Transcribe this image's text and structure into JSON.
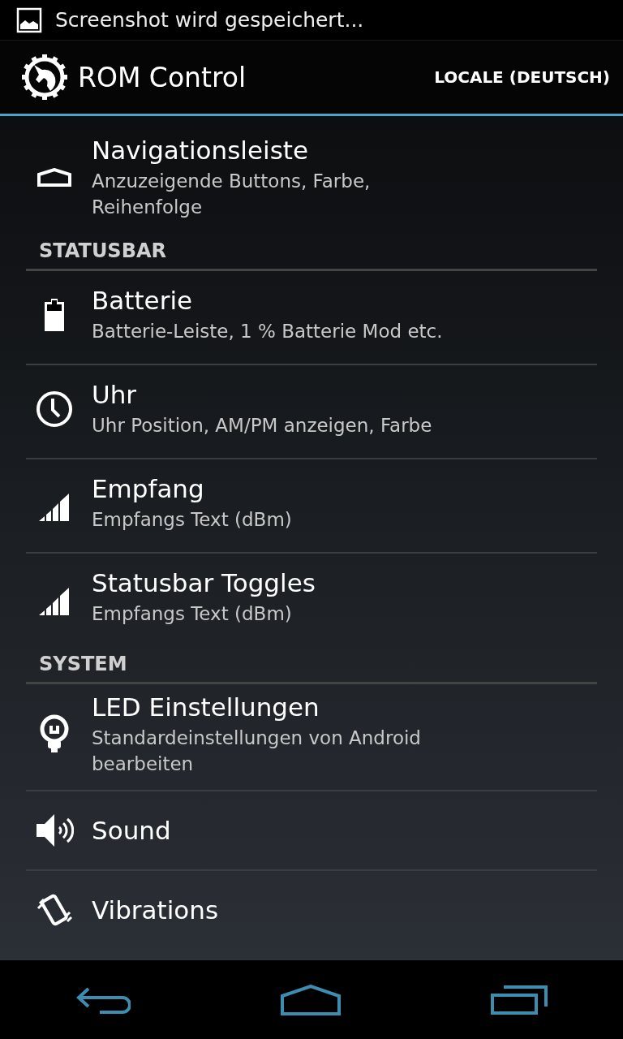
{
  "notification": {
    "text": "Screenshot wird gespeichert..."
  },
  "action_bar": {
    "title": "ROM Control",
    "action": "LOCALE (DEUTSCH)"
  },
  "entries": [
    {
      "kind": "item",
      "title": "Navigationsleiste",
      "summary": "Anzuzeigende Buttons, Farbe, Reihenfolge"
    },
    {
      "kind": "header",
      "title": "STATUSBAR"
    },
    {
      "kind": "item",
      "title": "Batterie",
      "summary": "Batterie-Leiste, 1 % Batterie Mod etc."
    },
    {
      "kind": "item",
      "title": "Uhr",
      "summary": "Uhr Position, AM/PM anzeigen, Farbe"
    },
    {
      "kind": "item",
      "title": "Empfang",
      "summary": "Empfangs Text (dBm)"
    },
    {
      "kind": "item",
      "title": "Statusbar Toggles",
      "summary": "Empfangs Text (dBm)"
    },
    {
      "kind": "header",
      "title": "SYSTEM"
    },
    {
      "kind": "item",
      "title": "LED Einstellungen",
      "summary": "Standardeinstellungen von Android bearbeiten"
    },
    {
      "kind": "item",
      "title": "Sound"
    },
    {
      "kind": "item",
      "title": "Vibrations"
    }
  ]
}
